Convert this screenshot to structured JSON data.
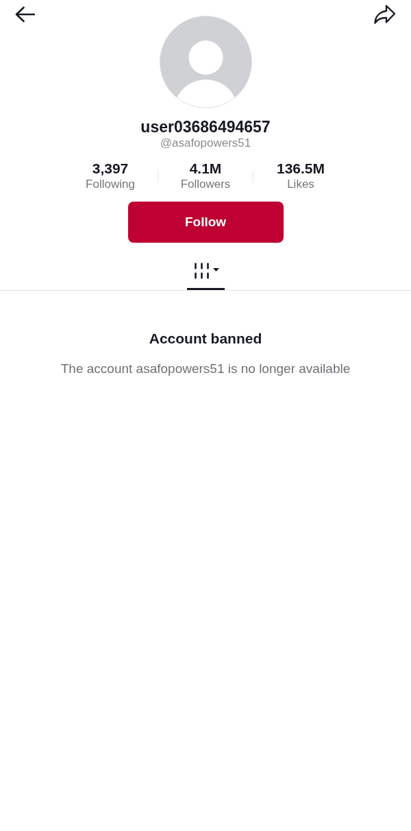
{
  "profile": {
    "display_name": "user03686494657",
    "handle": "@asafopowers51"
  },
  "stats": [
    {
      "value": "3,397",
      "label": "Following"
    },
    {
      "value": "4.1M",
      "label": "Followers"
    },
    {
      "value": "136.5M",
      "label": "Likes"
    }
  ],
  "follow_button": {
    "label": "Follow"
  },
  "tabs": [
    {
      "selected": true
    }
  ],
  "empty_state": {
    "title": "Account banned",
    "message": "The account asafopowers51 is no longer available"
  }
}
